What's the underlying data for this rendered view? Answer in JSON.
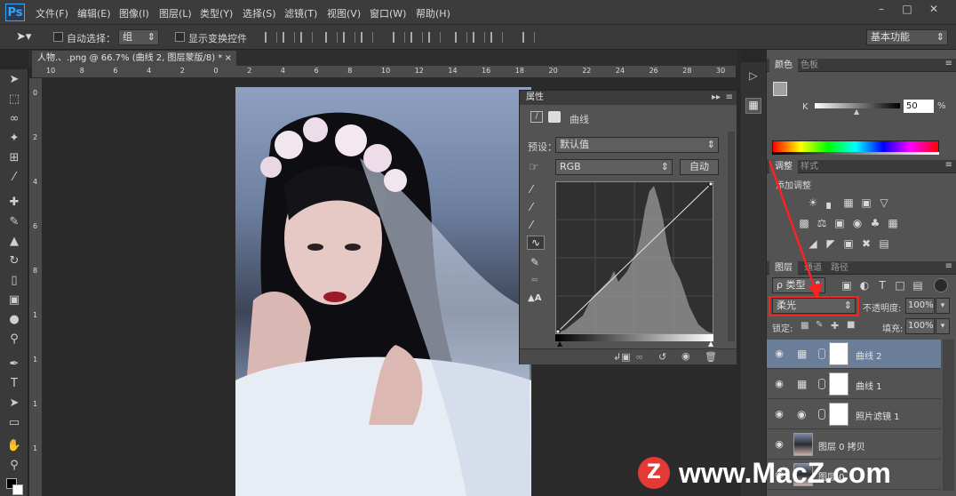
{
  "menubar": {
    "logo": "Ps",
    "items": [
      "文件(F)",
      "编辑(E)",
      "图像(I)",
      "图层(L)",
      "类型(Y)",
      "选择(S)",
      "滤镜(T)",
      "视图(V)",
      "窗口(W)",
      "帮助(H)"
    ],
    "window_controls": [
      "minimize-icon",
      "restore-icon",
      "close-icon"
    ]
  },
  "options": {
    "auto_select_label": "自动选择：",
    "auto_select_value": "组",
    "show_transform_label": "显示变换控件",
    "workspace": "基本功能"
  },
  "document": {
    "tab_title": "人物.、.png @ 66.7% (曲线 2, 图层蒙版/8) *",
    "ruler_h": [
      "10",
      "8",
      "6",
      "4",
      "2",
      "0",
      "2",
      "4",
      "6",
      "8",
      "10",
      "12",
      "14",
      "16",
      "18",
      "20",
      "22",
      "24",
      "26",
      "28",
      "30"
    ],
    "ruler_v": [
      "0",
      "2",
      "4",
      "6",
      "8",
      "1",
      "1",
      "1",
      "1"
    ]
  },
  "toolbar": {
    "tools": [
      "move-tool-icon",
      "marquee-tool-icon",
      "lasso-tool-icon",
      "quick-select-icon",
      "crop-icon",
      "eyedropper-icon",
      "healing-brush-icon",
      "brush-icon",
      "clone-stamp-icon",
      "history-brush-icon",
      "eraser-icon",
      "gradient-icon",
      "blur-icon",
      "dodge-icon",
      "pen-icon",
      "type-icon",
      "path-select-icon",
      "rectangle-icon",
      "hand-icon",
      "zoom-icon",
      "color-swatch-icon",
      "quick-mask-icon"
    ]
  },
  "properties": {
    "title": "属性",
    "panel_name": "曲线",
    "preset_label": "预设：",
    "preset_value": "默认值",
    "channel_value": "RGB",
    "auto_label": "自动"
  },
  "color_panel": {
    "tabs": [
      "颜色",
      "色板"
    ],
    "k_label": "K",
    "k_value": "50",
    "k_unit": "%",
    "k_fraction": 0.5
  },
  "adjustments": {
    "tabs": [
      "调整",
      "样式"
    ],
    "title": "添加调整"
  },
  "layers_panel": {
    "tabs": [
      "图层",
      "通道",
      "路径"
    ],
    "filter_label": "ρ 类型",
    "blend_mode": "柔光",
    "opacity_label": "不透明度:",
    "opacity_value": "100%",
    "lock_label": "锁定:",
    "fill_label": "填充:",
    "fill_value": "100%",
    "layers": [
      {
        "name": "曲线 2",
        "type": "curves",
        "selected": true
      },
      {
        "name": "曲线 1",
        "type": "curves",
        "selected": false
      },
      {
        "name": "照片滤镜 1",
        "type": "photo-filter",
        "selected": false
      },
      {
        "name": "图层 0 拷贝",
        "type": "image",
        "selected": false
      },
      {
        "name": "图层 0",
        "type": "image",
        "selected": false
      }
    ]
  },
  "watermark": {
    "logo": "Z",
    "text": "www.MacZ.com"
  },
  "colors": {
    "accent": "#e53935",
    "annotation": "#ff2020",
    "selected_layer": "#6a7d99"
  }
}
